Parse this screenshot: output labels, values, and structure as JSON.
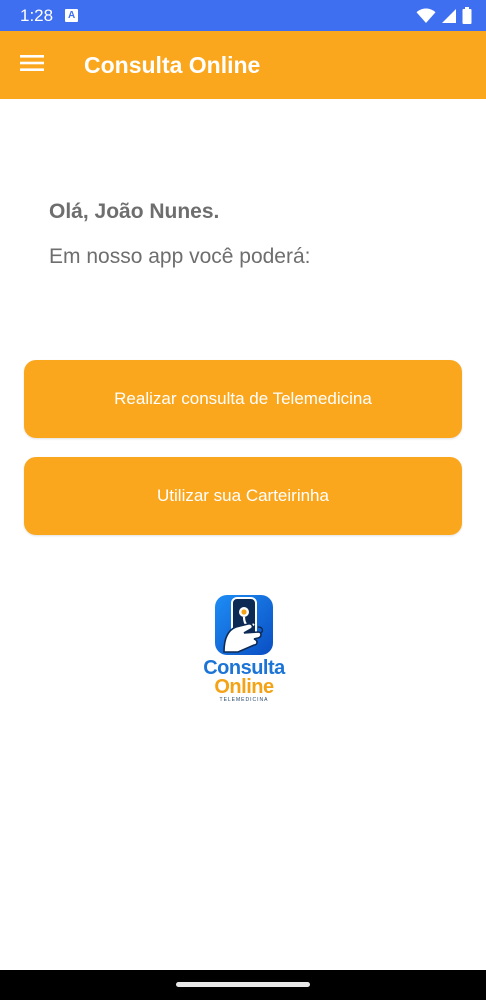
{
  "status_bar": {
    "time": "1:28",
    "app_icon_letter": "A",
    "icons": [
      "wifi-icon",
      "signal-icon",
      "battery-icon"
    ],
    "background": "#3e6ff1"
  },
  "app_bar": {
    "title": "Consulta Online",
    "menu_icon": "hamburger-menu-icon",
    "background": "#fba71e"
  },
  "main": {
    "greeting": "Olá, João Nunes.",
    "subtitle": "Em nosso app você poderá:",
    "buttons": [
      {
        "label": "Realizar consulta de Telemedicina"
      },
      {
        "label": "Utilizar sua Carteirinha"
      }
    ],
    "accent_color": "#fba71e"
  },
  "logo": {
    "line1": "Consulta",
    "line2": "Online",
    "line3": "TELEMEDICINA",
    "icon": "phone-stethoscope-logo-icon"
  }
}
